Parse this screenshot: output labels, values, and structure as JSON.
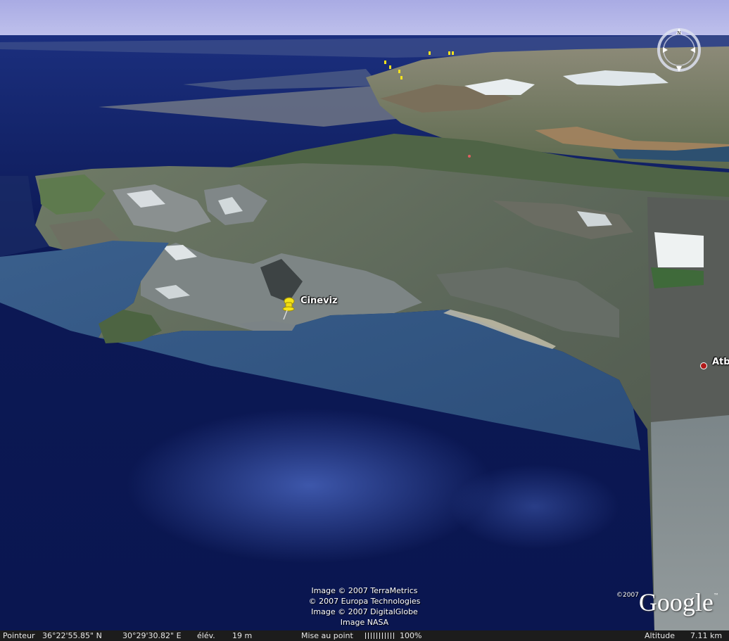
{
  "placemarks": {
    "pin_label": "Cineviz",
    "city_label": "Atb"
  },
  "credits": {
    "line1": "Image © 2007 TerraMetrics",
    "line2": "© 2007 Europa Technologies",
    "line3": "Image © 2007 DigitalGlobe",
    "line4": "Image NASA"
  },
  "logo": {
    "year": "©2007",
    "word": "Google",
    "tm": "™"
  },
  "status": {
    "pointer_label": "Pointeur",
    "lat": "36°22'55.85\" N",
    "lon": "30°29'30.82\" E",
    "elev_label": "élév.",
    "elev_value": "19 m",
    "focus_label": "Mise au point",
    "focus_value": "100%",
    "focus_fraction": 1.0,
    "altitude_label": "Altitude",
    "altitude_value": "7.11 km"
  },
  "colors": {
    "sky": "#aeb0e6",
    "sea_deep": "#0e1f5e",
    "sea_shallow": "#2f5684",
    "land": "#5e6a5a",
    "city_dot": "#b01a1a"
  }
}
